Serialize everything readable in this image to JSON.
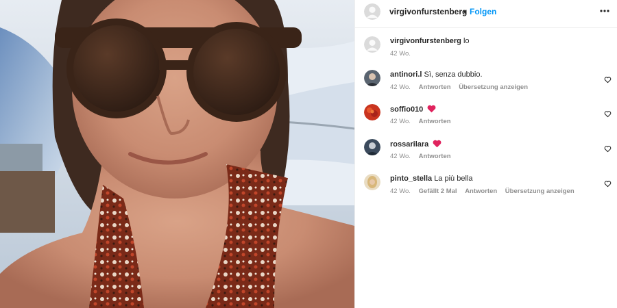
{
  "post": {
    "username": "virgivonfurstenberg",
    "separator": "•",
    "follow_label": "Folgen",
    "more_icon": "more-horizontal-icon"
  },
  "caption": {
    "username": "virgivonfurstenberg",
    "text": "lo",
    "time": "42 Wo."
  },
  "comments": [
    {
      "username": "antinori.l",
      "text": "Sì, senza dubbio.",
      "time": "42 Wo.",
      "reply_label": "Antworten",
      "translate_label": "Übersetzung anzeigen",
      "avatar_color": "#5a6470"
    },
    {
      "username": "soffio010",
      "text": "",
      "has_heart_emoji": true,
      "time": "42 Wo.",
      "reply_label": "Antworten",
      "avatar_color": "#c9341f"
    },
    {
      "username": "rossarilara",
      "text": "",
      "has_heart_emoji": true,
      "time": "42 Wo.",
      "reply_label": "Antworten",
      "avatar_color": "#3b4a5c"
    },
    {
      "username": "pinto_stella",
      "text": "La più bella",
      "time": "42 Wo.",
      "likes_label": "Gefällt 2 Mal",
      "reply_label": "Antworten",
      "translate_label": "Übersetzung anzeigen",
      "avatar_color": "#d8b77a"
    }
  ],
  "colors": {
    "accent": "#0095f6",
    "text": "#262626",
    "muted": "#8e8e8e",
    "divider": "#efefef",
    "heart_emoji": "#e0245e"
  }
}
